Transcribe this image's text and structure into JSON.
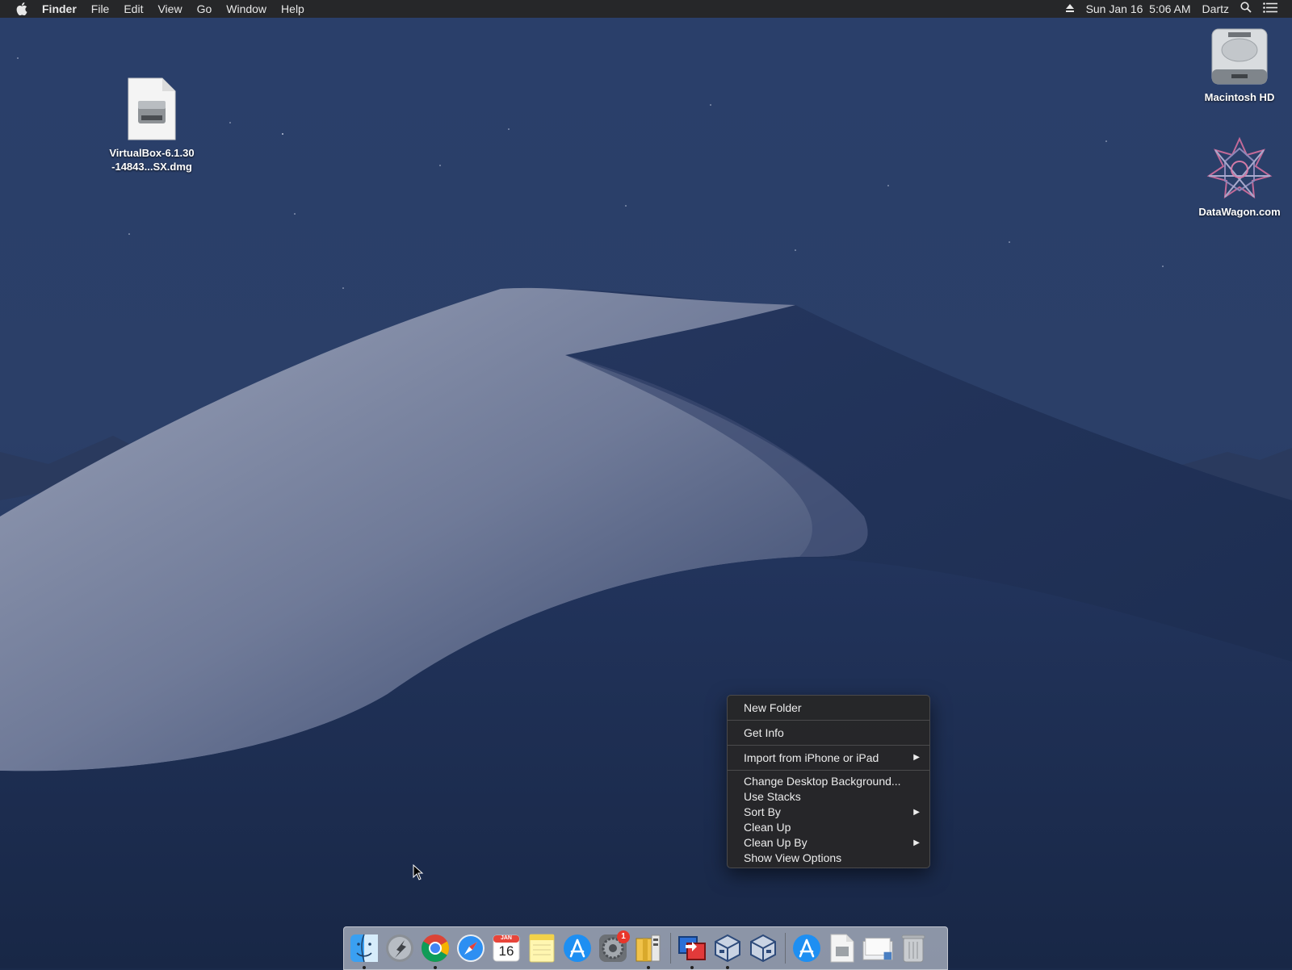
{
  "menubar": {
    "app_name": "Finder",
    "items": [
      "File",
      "Edit",
      "View",
      "Go",
      "Window",
      "Help"
    ],
    "clock": "Sun Jan 16  5:06 AM",
    "user": "Dartz"
  },
  "desktop": {
    "icons": [
      {
        "name": "vbox-dmg",
        "label_line1": "VirtualBox-6.1.30",
        "label_line2": "-14843...SX.dmg",
        "icon": "disk-image-icon"
      },
      {
        "name": "macintosh-hd",
        "label": "Macintosh HD",
        "icon": "hard-drive-icon"
      },
      {
        "name": "datawagon",
        "label": "DataWagon.com",
        "icon": "network-share-icon"
      }
    ]
  },
  "context_menu": {
    "items": [
      {
        "label": "New Folder"
      },
      {
        "label": "Get Info"
      },
      {
        "label": "Import from iPhone or iPad",
        "submenu": true
      },
      {
        "label": "Change Desktop Background..."
      },
      {
        "label": "Use Stacks"
      },
      {
        "label": "Sort By",
        "submenu": true
      },
      {
        "label": "Clean Up"
      },
      {
        "label": "Clean Up By",
        "submenu": true
      },
      {
        "label": "Show View Options"
      }
    ]
  },
  "dock": {
    "apps": [
      {
        "name": "finder-icon",
        "running": true
      },
      {
        "name": "launchpad-icon",
        "running": false
      },
      {
        "name": "chrome-icon",
        "running": true
      },
      {
        "name": "safari-icon",
        "running": false
      },
      {
        "name": "calendar-icon",
        "running": false,
        "calendar_day": "16",
        "calendar_month": "JAN"
      },
      {
        "name": "notes-icon",
        "running": false
      },
      {
        "name": "app-store-icon",
        "running": false
      },
      {
        "name": "system-preferences-icon",
        "running": false,
        "badge": "1"
      },
      {
        "name": "archive-utility-icon",
        "running": true
      },
      {
        "name": "remote-desktop-icon",
        "running": true
      },
      {
        "name": "virtualbox-icon",
        "running": true
      },
      {
        "name": "virtualbox-2-icon",
        "running": false
      },
      {
        "name": "app-store-folder-icon",
        "running": false
      },
      {
        "name": "document-icon",
        "running": false
      },
      {
        "name": "downloads-stack-icon",
        "running": false
      },
      {
        "name": "trash-icon",
        "running": false
      }
    ]
  },
  "colors": {
    "menubar_bg": "#262729",
    "menu_bg": "#262628",
    "sky_top": "#243a66",
    "dune_light": "#8a93ad"
  }
}
